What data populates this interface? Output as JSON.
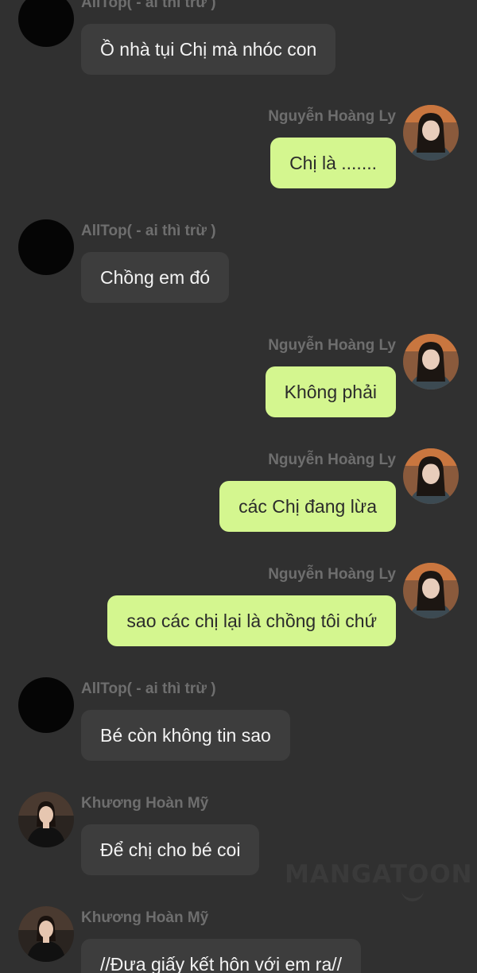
{
  "watermark": "MANGATOON",
  "messages": [
    {
      "side": "left",
      "avatar": "black-avatar",
      "name": "AllTop( - ai thì trừ )",
      "text": "Ồ nhà tụi Chị mà nhóc con"
    },
    {
      "side": "right",
      "avatar": "girl-avatar",
      "name": "Nguyễn Hoàng Ly",
      "text": "Chị là ......."
    },
    {
      "side": "left",
      "avatar": "black-avatar",
      "name": "AllTop( - ai thì trừ )",
      "text": "Chồng em đó"
    },
    {
      "side": "right",
      "avatar": "girl-avatar",
      "name": "Nguyễn Hoàng Ly",
      "text": "Không phải"
    },
    {
      "side": "right",
      "avatar": "girl-avatar",
      "name": "Nguyễn Hoàng Ly",
      "text": "các Chị đang lừa"
    },
    {
      "side": "right",
      "avatar": "girl-avatar",
      "name": "Nguyễn Hoàng Ly",
      "text": "sao các chị lại là chồng tôi chứ"
    },
    {
      "side": "left",
      "avatar": "black-avatar",
      "name": "AllTop( - ai thì trừ )",
      "text": "Bé còn không tin sao"
    },
    {
      "side": "left",
      "avatar": "woman-avatar",
      "name": "Khương Hoàn Mỹ",
      "text": "Để chị cho bé coi"
    },
    {
      "side": "left",
      "avatar": "woman-avatar",
      "name": "Khương Hoàn Mỹ",
      "text": "//Đưa giấy kết hôn với em ra//"
    }
  ]
}
